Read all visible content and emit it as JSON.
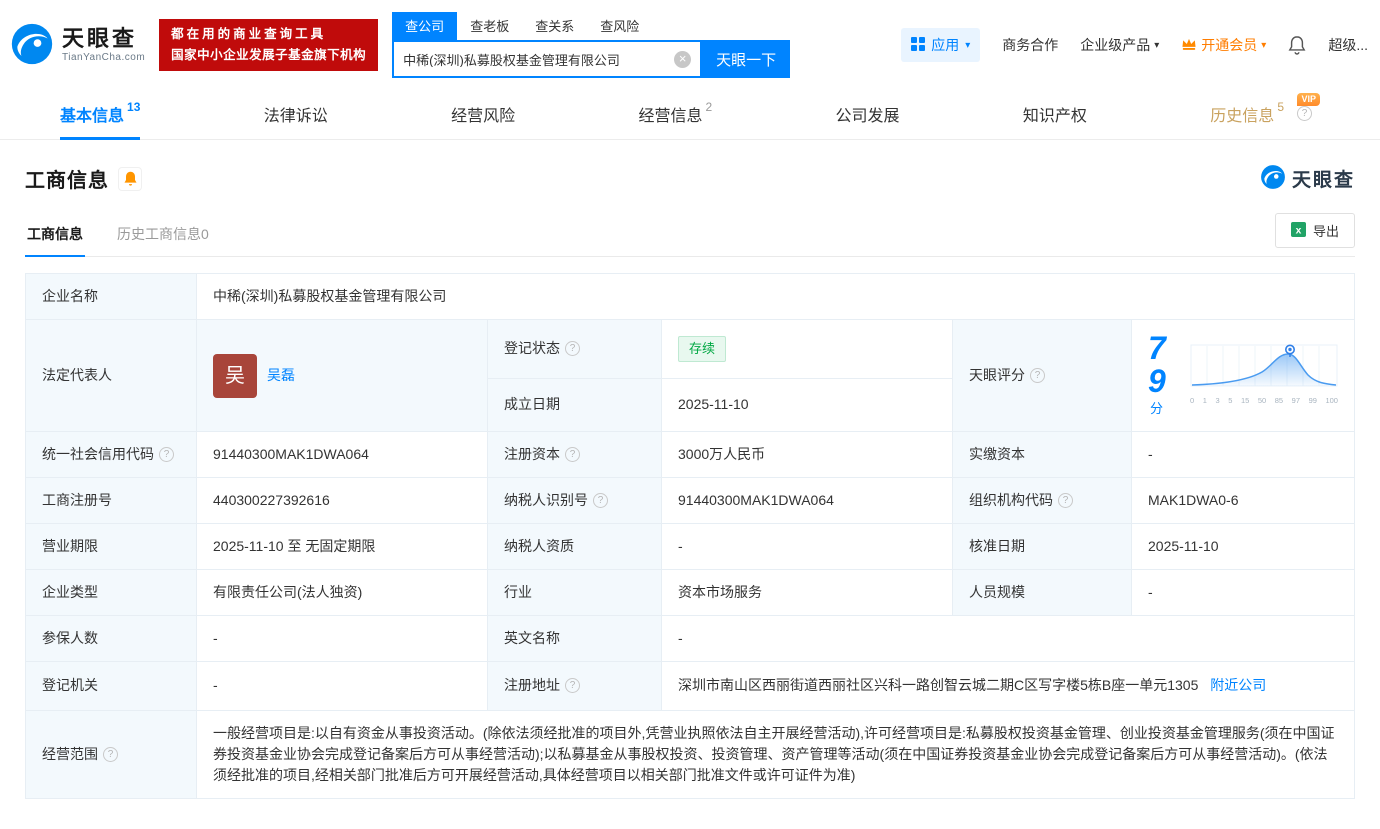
{
  "icons": {
    "help": "?",
    "clear": "×",
    "caret": "▾"
  },
  "header": {
    "logo_title": "天眼查",
    "logo_subtitle": "TianYanCha.com",
    "slogan_line1": "都在用的商业查询工具",
    "slogan_line2": "国家中小企业发展子基金旗下机构",
    "search_tabs": [
      {
        "label": "查公司"
      },
      {
        "label": "查老板"
      },
      {
        "label": "查关系"
      },
      {
        "label": "查风险"
      }
    ],
    "search_value": "中稀(深圳)私募股权基金管理有限公司",
    "search_button": "天眼一下",
    "nav": {
      "apps": "应用",
      "cooperation": "商务合作",
      "enterprise": "企业级产品",
      "vip": "开通会员",
      "more": "超级..."
    }
  },
  "tabs": [
    {
      "label": "基本信息",
      "count": "13"
    },
    {
      "label": "法律诉讼"
    },
    {
      "label": "经营风险"
    },
    {
      "label": "经营信息",
      "count": "2"
    },
    {
      "label": "公司发展"
    },
    {
      "label": "知识产权"
    },
    {
      "label": "历史信息",
      "count": "5",
      "vip_badge": "VIP"
    }
  ],
  "section": {
    "title": "工商信息",
    "logo_title": "天眼查",
    "subtab_active": "工商信息",
    "subtab_history": "历史工商信息0",
    "export_label": "导出"
  },
  "table": {
    "company_name": {
      "label": "企业名称",
      "value": "中稀(深圳)私募股权基金管理有限公司"
    },
    "legal_rep": {
      "label": "法定代表人",
      "avatar_char": "吴",
      "name": "吴磊"
    },
    "reg_status": {
      "label": "登记状态",
      "value": "存续"
    },
    "establish_date": {
      "label": "成立日期",
      "value": "2025-11-10"
    },
    "score": {
      "label": "天眼评分",
      "value": "79",
      "unit": "分"
    },
    "credit_code": {
      "label": "统一社会信用代码",
      "value": "91440300MAK1DWA064"
    },
    "reg_capital": {
      "label": "注册资本",
      "value": "3000万人民币"
    },
    "paid_capital": {
      "label": "实缴资本",
      "value": "-"
    },
    "reg_number": {
      "label": "工商注册号",
      "value": "440300227392616"
    },
    "taxpayer_id": {
      "label": "纳税人识别号",
      "value": "91440300MAK1DWA064"
    },
    "org_code": {
      "label": "组织机构代码",
      "value": "MAK1DWA0-6"
    },
    "business_term": {
      "label": "营业期限",
      "value": "2025-11-10 至 无固定期限"
    },
    "taxpayer_qual": {
      "label": "纳税人资质",
      "value": "-"
    },
    "approval_date": {
      "label": "核准日期",
      "value": "2025-11-10"
    },
    "company_type": {
      "label": "企业类型",
      "value": "有限责任公司(法人独资)"
    },
    "industry": {
      "label": "行业",
      "value": "资本市场服务"
    },
    "staff_size": {
      "label": "人员规模",
      "value": "-"
    },
    "insured_count": {
      "label": "参保人数",
      "value": "-"
    },
    "english_name": {
      "label": "英文名称",
      "value": "-"
    },
    "reg_authority": {
      "label": "登记机关",
      "value": "-"
    },
    "reg_address": {
      "label": "注册地址",
      "value": "深圳市南山区西丽街道西丽社区兴科一路创智云城二期C区写字楼5栋B座一单元1305",
      "link": "附近公司"
    },
    "business_scope": {
      "label": "经营范围",
      "value": "一般经营项目是:以自有资金从事投资活动。(除依法须经批准的项目外,凭营业执照依法自主开展经营活动),许可经营项目是:私募股权投资基金管理、创业投资基金管理服务(须在中国证券投资基金业协会完成登记备案后方可从事经营活动);以私募基金从事股权投资、投资管理、资产管理等活动(须在中国证券投资基金业协会完成登记备案后方可从事经营活动)。(依法须经批准的项目,经相关部门批准后方可开展经营活动,具体经营项目以相关部门批准文件或许可证件为准)"
    }
  },
  "score_chart": {
    "ticks": [
      "0",
      "1",
      "3",
      "5",
      "15",
      "50",
      "85",
      "97",
      "99",
      "100"
    ]
  }
}
